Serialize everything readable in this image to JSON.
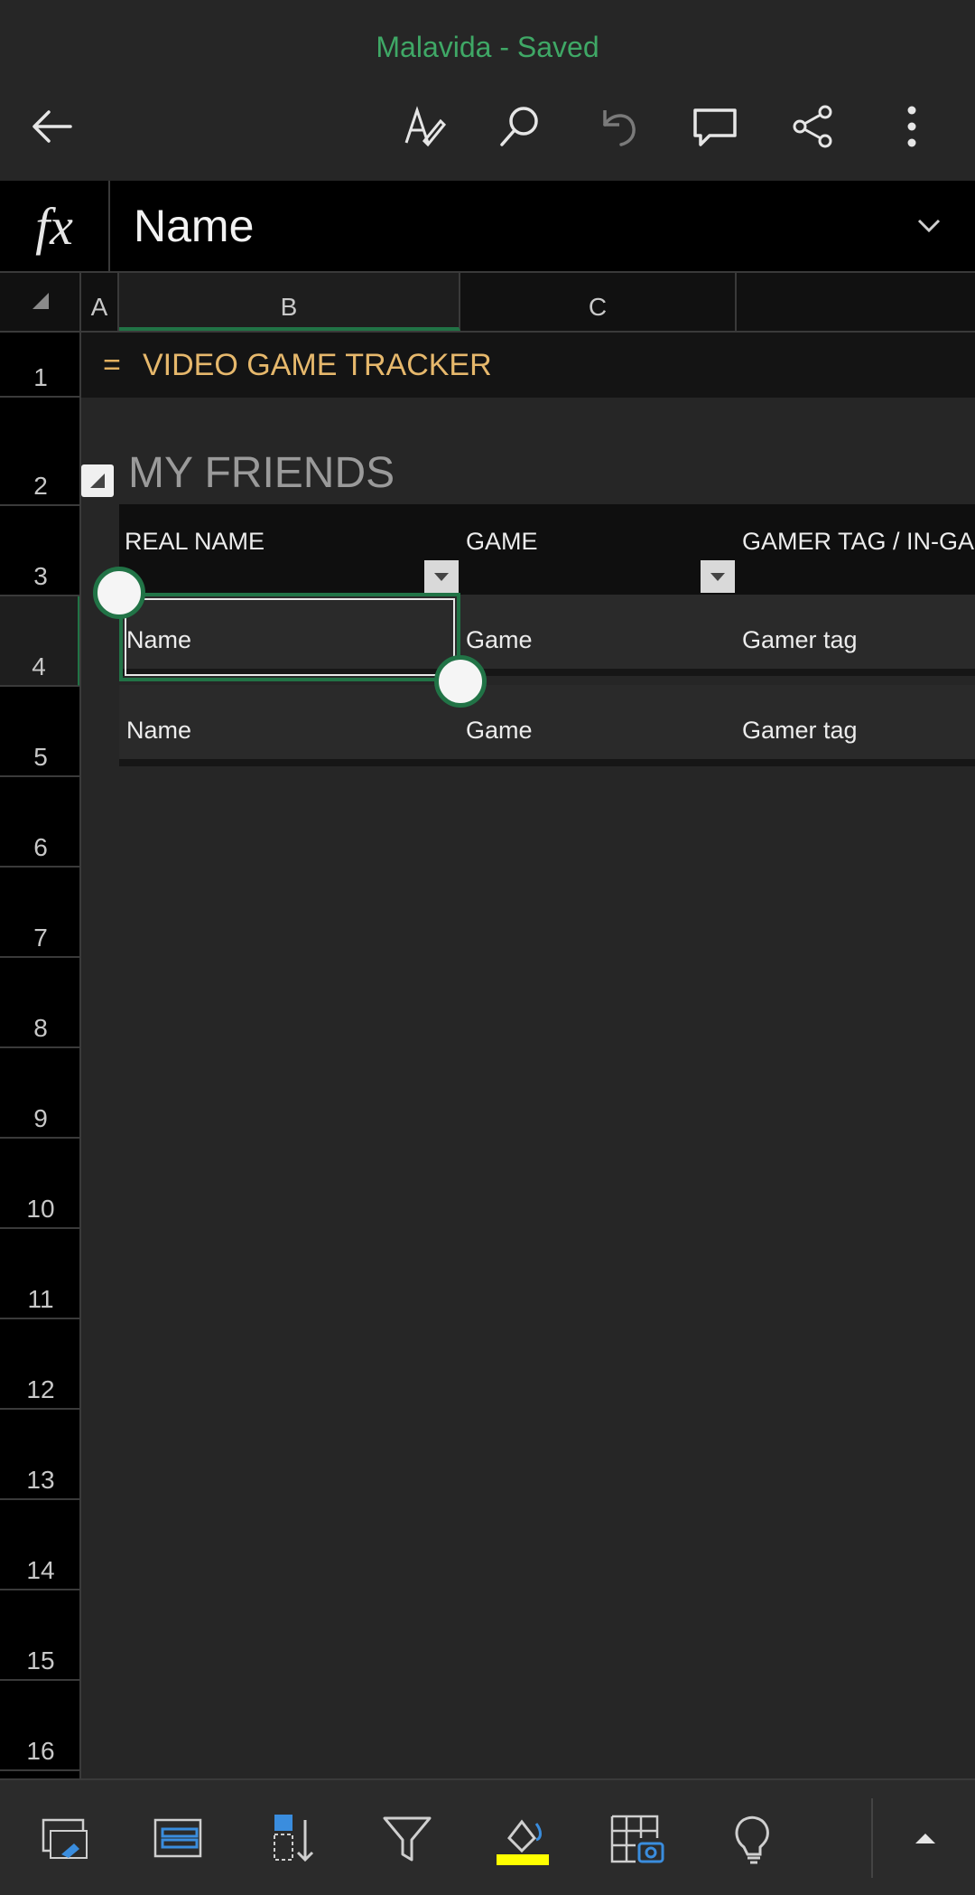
{
  "app": {
    "doc_title": "Malavida - Saved"
  },
  "formula_bar": {
    "fx_label": "fx",
    "value": "Name"
  },
  "column_headers": [
    "A",
    "B",
    "C"
  ],
  "row_headers": [
    "1",
    "2",
    "3",
    "4",
    "5",
    "6",
    "7",
    "8",
    "9",
    "10",
    "11",
    "12",
    "13",
    "14",
    "15",
    "16"
  ],
  "sheet": {
    "title_prefix": "=",
    "title": "VIDEO GAME TRACKER",
    "section": "MY FRIENDS",
    "table": {
      "headers": [
        "REAL NAME",
        "GAME",
        "GAMER TAG / IN-GA"
      ],
      "rows": [
        [
          "Name",
          "Game",
          "Gamer tag"
        ],
        [
          "Name",
          "Game",
          "Gamer tag"
        ]
      ]
    }
  },
  "colors": {
    "accent": "#217346",
    "title_text": "#e6b86c",
    "saved_text": "#3fa866",
    "highlight": "#ffff00"
  }
}
